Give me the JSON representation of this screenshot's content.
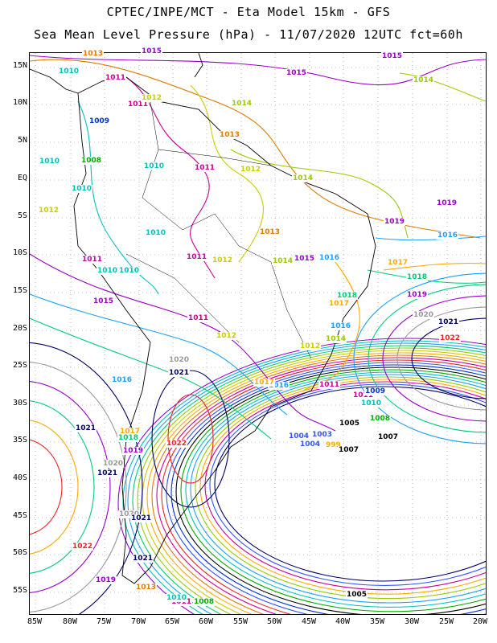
{
  "header": {
    "line1": "CPTEC/INPE/MCT -  Eta Model 15km - GFS",
    "line2": "Sea Mean Level Pressure (hPa) - 11/07/2020 12UTC fct=60h"
  },
  "axes": {
    "lat_labels": [
      "15N",
      "10N",
      "5N",
      "EQ",
      "5S",
      "10S",
      "15S",
      "20S",
      "25S",
      "30S",
      "35S",
      "40S",
      "45S",
      "50S",
      "55S"
    ],
    "lon_labels": [
      "85W",
      "80W",
      "75W",
      "70W",
      "65W",
      "60W",
      "55W",
      "50W",
      "45W",
      "40W",
      "35W",
      "30W",
      "25W",
      "20W"
    ]
  },
  "isobar_labels": [
    {
      "text": "1015",
      "color": "#9900cc"
    },
    {
      "text": "1013",
      "color": "#e07b00"
    },
    {
      "text": "1011",
      "color": "#cc0099"
    },
    {
      "text": "1010",
      "color": "#00bfbf"
    },
    {
      "text": "1009",
      "color": "#0033cc"
    },
    {
      "text": "1008",
      "color": "#00aa00"
    },
    {
      "text": "1014",
      "color": "#99cc00"
    },
    {
      "text": "1012",
      "color": "#cccc00"
    },
    {
      "text": "1016",
      "color": "#1f9fff"
    },
    {
      "text": "1017",
      "color": "#ffaa00"
    },
    {
      "text": "1018",
      "color": "#00cc77"
    },
    {
      "text": "1019",
      "color": "#9900cc"
    },
    {
      "text": "1020",
      "color": "#999999"
    },
    {
      "text": "1021",
      "color": "#000066"
    },
    {
      "text": "1022",
      "color": "#ee2222"
    },
    {
      "text": "1005",
      "color": "#000000"
    },
    {
      "text": "1004",
      "color": "#3355ff"
    },
    {
      "text": "999",
      "color": "#ffaa00"
    },
    {
      "text": "1003",
      "color": "#3355ff"
    },
    {
      "text": "1007",
      "color": "#000000"
    }
  ],
  "colors": {
    "low_center": "#000000",
    "high_center": "#ee2222",
    "coastline": "#000000",
    "grid": "#888888"
  }
}
